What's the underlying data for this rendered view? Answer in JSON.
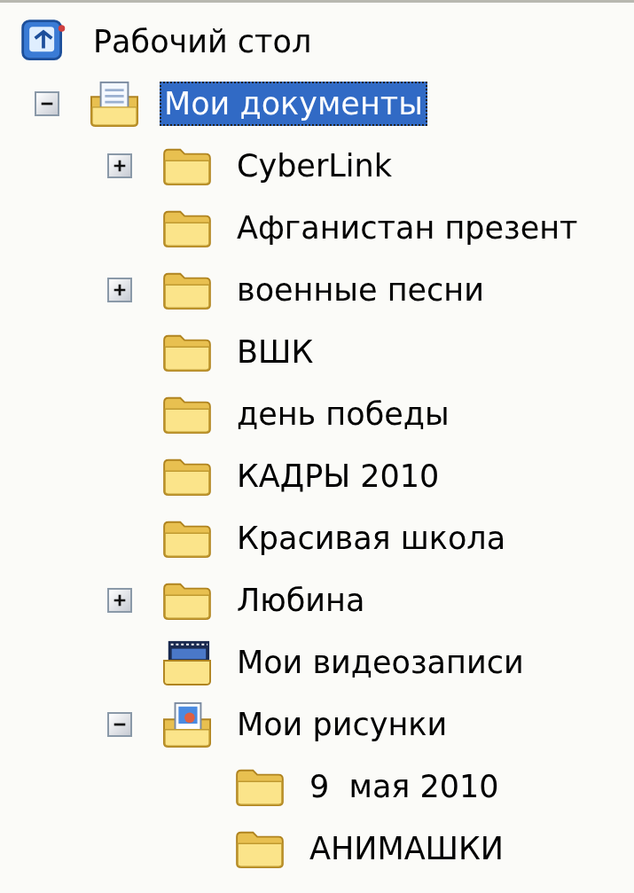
{
  "tree": [
    {
      "kind": "desktop",
      "label": "Рабочий стол",
      "selected": false,
      "children": [
        {
          "kind": "documents",
          "label": "Мои документы",
          "selected": true,
          "expanded": true,
          "children": [
            {
              "kind": "folder",
              "label": "CyberLink",
              "selected": false,
              "expanded": false
            },
            {
              "kind": "folder",
              "label": "Афганистан презент",
              "selected": false
            },
            {
              "kind": "folder",
              "label": "военные песни",
              "selected": false,
              "expanded": false
            },
            {
              "kind": "folder",
              "label": "ВШК",
              "selected": false
            },
            {
              "kind": "folder",
              "label": "день победы",
              "selected": false
            },
            {
              "kind": "folder",
              "label": "КАДРЫ 2010",
              "selected": false
            },
            {
              "kind": "folder",
              "label": "Красивая школа",
              "selected": false
            },
            {
              "kind": "folder",
              "label": "Любина",
              "selected": false,
              "expanded": false
            },
            {
              "kind": "videos",
              "label": "Мои видеозаписи",
              "selected": false
            },
            {
              "kind": "pictures",
              "label": "Мои рисунки",
              "selected": false,
              "expanded": true,
              "children": [
                {
                  "kind": "folder",
                  "label": "9  мая 2010",
                  "selected": false
                },
                {
                  "kind": "folder",
                  "label": "АНИМАШКИ",
                  "selected": false
                }
              ]
            }
          ]
        }
      ]
    }
  ]
}
